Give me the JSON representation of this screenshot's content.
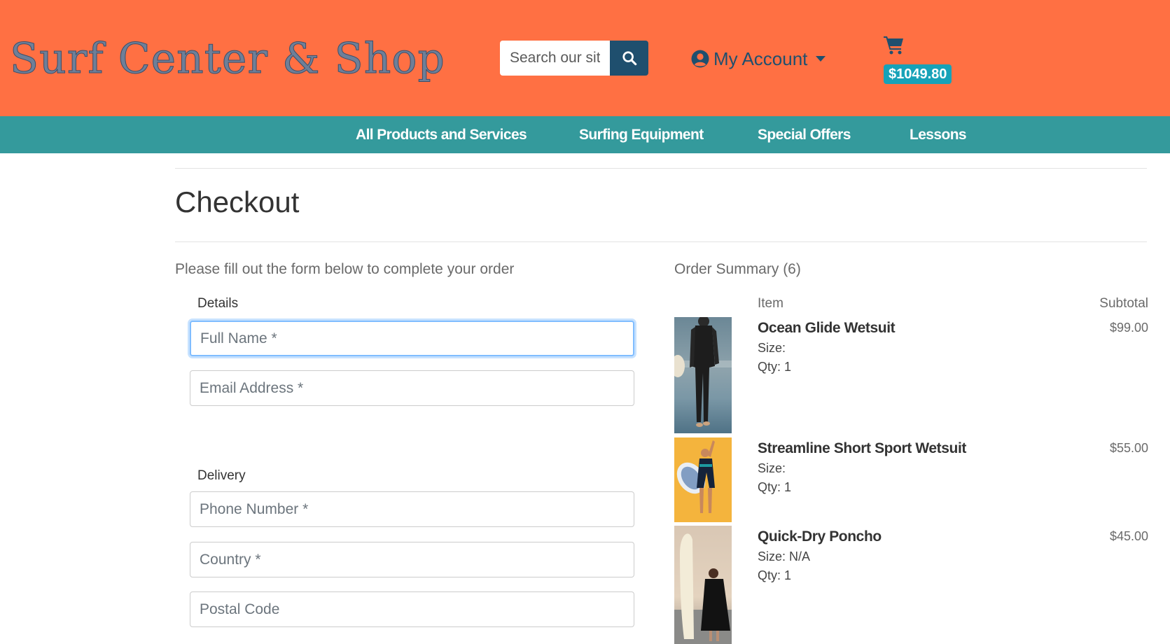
{
  "header": {
    "logo": "Surf Center & Shop",
    "search": {
      "placeholder": "Search our site",
      "button_icon": "search-icon"
    },
    "account": {
      "label": "My Account",
      "icon": "user-circle-icon"
    },
    "cart": {
      "icon": "shopping-cart-icon",
      "total": "$1049.80"
    }
  },
  "nav": {
    "items": [
      {
        "label": "All Products and Services"
      },
      {
        "label": "Surfing Equipment"
      },
      {
        "label": "Special Offers"
      },
      {
        "label": "Lessons"
      }
    ]
  },
  "main": {
    "title": "Checkout",
    "intro": "Please fill out the form below to complete your order",
    "form": {
      "details_label": "Details",
      "delivery_label": "Delivery",
      "full_name": {
        "placeholder": "Full Name *",
        "value": ""
      },
      "email": {
        "placeholder": "Email Address *",
        "value": ""
      },
      "phone": {
        "placeholder": "Phone Number *",
        "value": ""
      },
      "country": {
        "placeholder": "Country *",
        "value": ""
      },
      "postal": {
        "placeholder": "Postal Code",
        "value": ""
      }
    },
    "summary": {
      "title": "Order Summary (6)",
      "col_item": "Item",
      "col_subtotal": "Subtotal",
      "size_label": "Size:",
      "qty_label": "Qty:",
      "items": [
        {
          "name": "Ocean Glide Wetsuit",
          "size": "",
          "qty": "1",
          "subtotal": "$99.00"
        },
        {
          "name": "Streamline Short Sport Wetsuit",
          "size": "",
          "qty": "1",
          "subtotal": "$55.00"
        },
        {
          "name": "Quick-Dry Poncho",
          "size": "N/A",
          "qty": "1",
          "subtotal": "$45.00"
        }
      ]
    }
  },
  "colors": {
    "header_bg": "#ff7043",
    "nav_bg": "#349a9c",
    "brand_dark": "#1f4f6e",
    "badge": "#17a2b8"
  }
}
